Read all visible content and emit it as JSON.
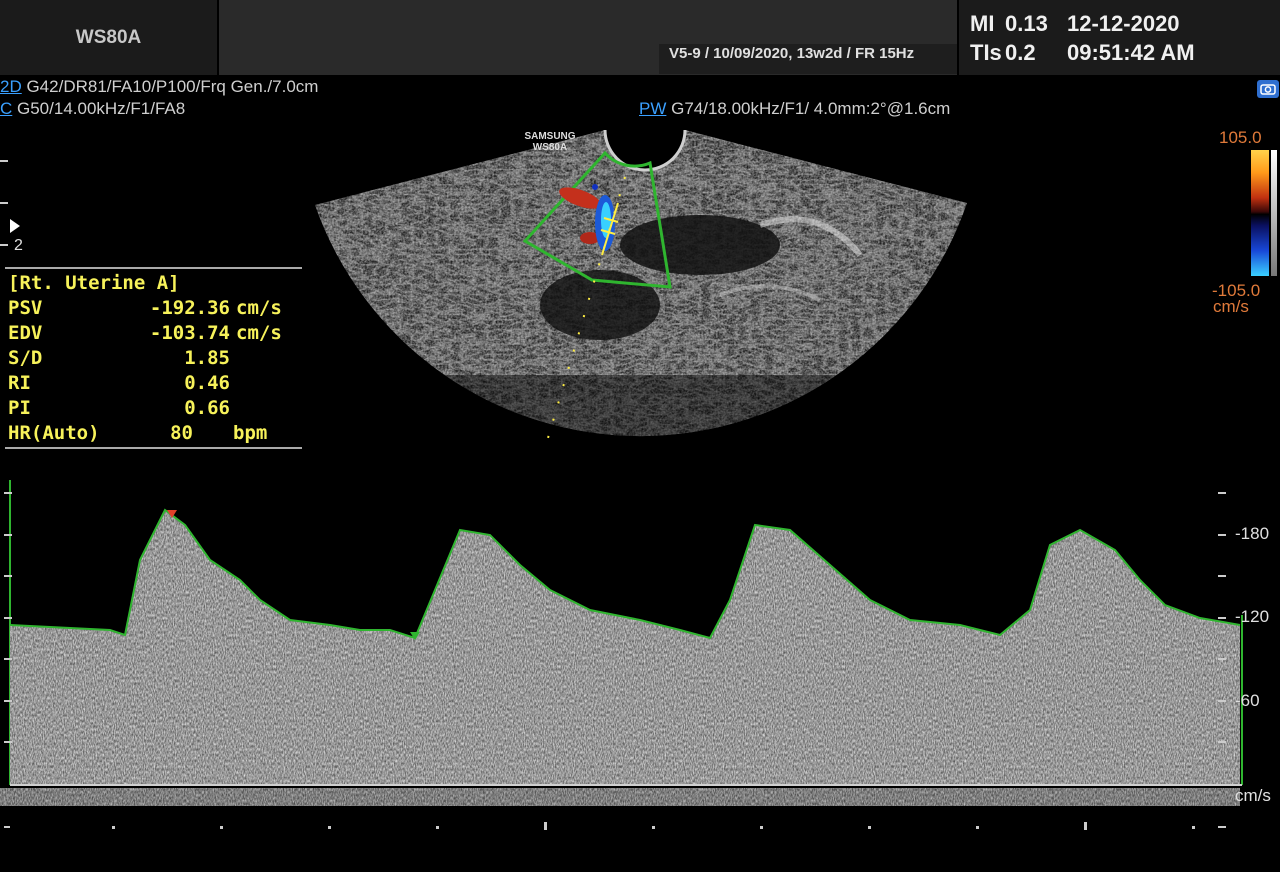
{
  "header": {
    "model": "WS80A",
    "probe_info": "V5-9 / 10/09/2020, 13w2d / FR 15Hz",
    "mi_label": "MI",
    "mi_value": "0.13",
    "tis_label": "TIs",
    "tis_value": "0.2",
    "date": "12-12-2020",
    "time": "09:51:42 AM"
  },
  "params": {
    "mode_2d": "2D",
    "params_2d": " G42/DR81/FA10/P100/Frq Gen./7.0cm",
    "mode_c": "C",
    "params_c": " G50/14.00kHz/F1/FA8",
    "mode_pw": "PW",
    "params_pw": " G74/18.00kHz/F1/ 4.0mm:2°@1.6cm"
  },
  "image": {
    "watermark_line1": "SAMSUNG",
    "watermark_line2": "WS80A",
    "depth_marker": "2"
  },
  "colorbar": {
    "max": "105.0",
    "min": "-105.0",
    "unit": "cm/s"
  },
  "measurements": {
    "title": "[Rt. Uterine A]",
    "rows": [
      {
        "label": "PSV",
        "value": "-192.36",
        "unit": "cm/s"
      },
      {
        "label": "EDV",
        "value": "-103.74",
        "unit": "cm/s"
      },
      {
        "label": "S/D",
        "value": "1.85",
        "unit": ""
      },
      {
        "label": "RI",
        "value": "0.46",
        "unit": ""
      },
      {
        "label": "PI",
        "value": "0.66",
        "unit": ""
      },
      {
        "label": "HR(Auto)",
        "value": "80",
        "unit": "bpm"
      }
    ]
  },
  "spectrum_scale": {
    "labels": [
      "-180",
      "-120",
      "-60"
    ],
    "unit": "cm/s"
  },
  "colors": {
    "measurement_text": "#f7f25a",
    "trace": "#2fb52f",
    "mode_label": "#3aa0ff",
    "colorbar_label": "#e07a3a"
  }
}
